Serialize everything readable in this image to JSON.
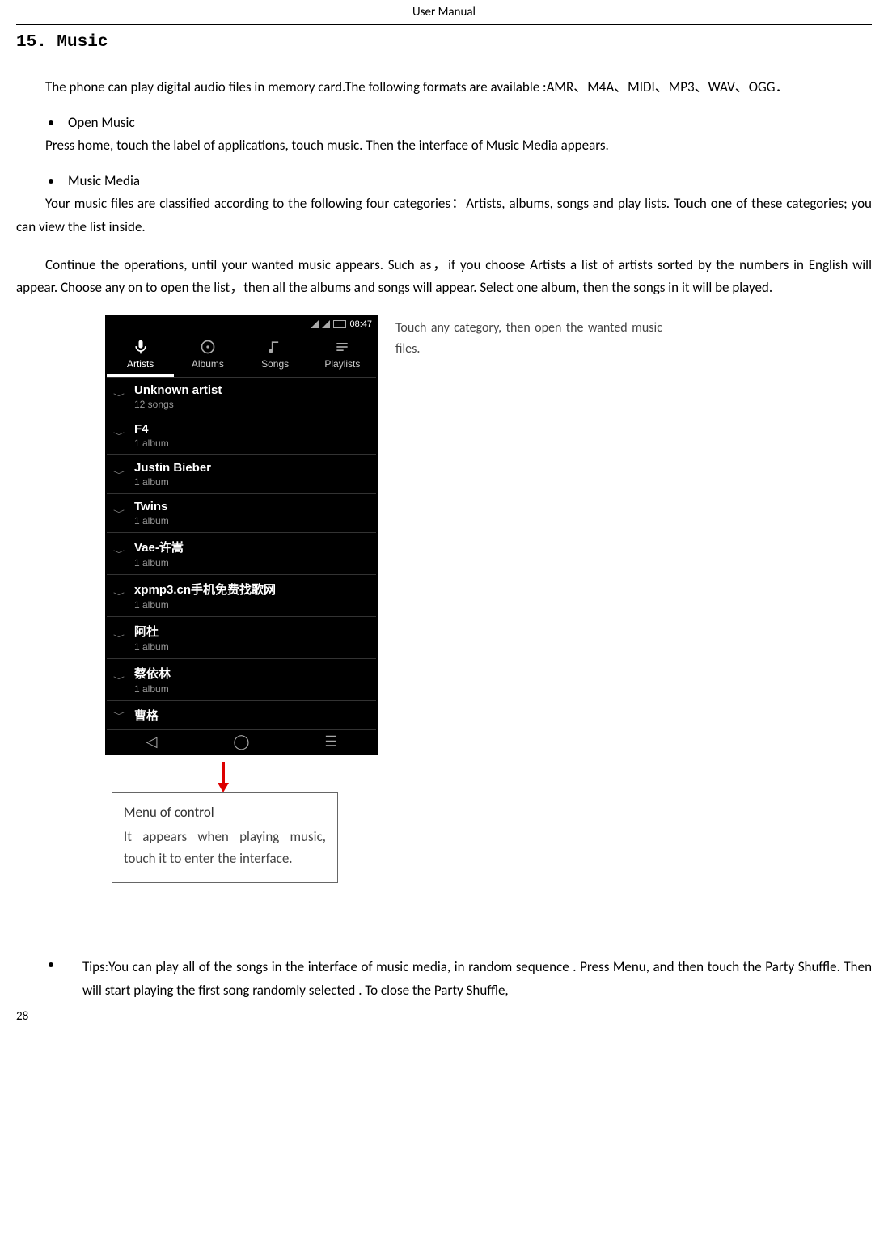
{
  "header": "User    Manual",
  "section_title": "15. Music",
  "intro": "The    phone can play digital audio files in memory card.The following formats are available :AMR、M4A、MIDI、MP3、WAV、OGG．",
  "bullets": {
    "open_music": {
      "label": "Open Music",
      "text": "Press home, touch the label of applications, touch music. Then the interface of Music Media appears."
    },
    "music_media": {
      "label": "Music Media",
      "text1": "Your music files are classified according to the following four categories：Artists, albums, songs and play lists. Touch one of these categories; you can view the list inside.",
      "text2": "Continue the operations, until your wanted music appears. Such as，if you choose Artists a list of artists sorted by the numbers in English will appear. Choose any on to open the list，then all the albums and songs will appear. Select one album, then the songs in it will be played."
    }
  },
  "phone": {
    "time": "08:47",
    "tabs": [
      {
        "label": "Artists"
      },
      {
        "label": "Albums"
      },
      {
        "label": "Songs"
      },
      {
        "label": "Playlists"
      }
    ],
    "artists": [
      {
        "name": "Unknown artist",
        "sub": "12 songs"
      },
      {
        "name": "F4",
        "sub": "1 album"
      },
      {
        "name": "Justin Bieber",
        "sub": "1 album"
      },
      {
        "name": "Twins",
        "sub": "1 album"
      },
      {
        "name": "Vae-许嵩",
        "sub": "1 album"
      },
      {
        "name": "xpmp3.cn手机免费找歌网",
        "sub": "1 album"
      },
      {
        "name": "阿杜",
        "sub": "1 album"
      },
      {
        "name": "蔡依林",
        "sub": "1 album"
      },
      {
        "name": "曹格",
        "sub": ""
      }
    ]
  },
  "callout_right": "Touch any category, then open the wanted music files.",
  "callout_box": {
    "title": "Menu of control",
    "body": "It appears when playing music, touch it to enter the interface."
  },
  "tips": "Tips:You can play all of the songs in the interface of    music media, in random sequence    . Press    Menu, and then touch the Party Shuffle. Then will start playing the first song randomly selected . To close the Party Shuffle,",
  "page_number": "28"
}
